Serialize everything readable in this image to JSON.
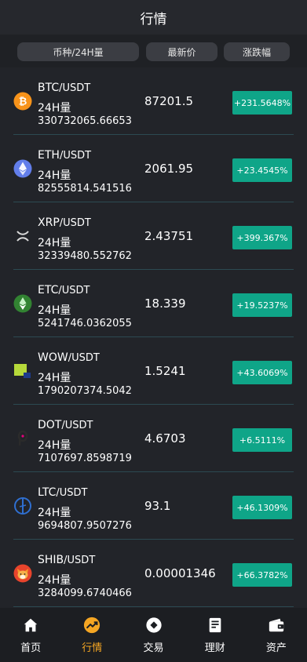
{
  "header": {
    "title": "行情"
  },
  "columns": {
    "pair": "币种/24H量",
    "price": "最新价",
    "change": "涨跌幅"
  },
  "markets": [
    {
      "base": "BTC",
      "quote": "/USDT",
      "vol_label": "24H量",
      "volume": "330732065.66653",
      "price": "87201.5",
      "change": "+231.5648%",
      "icon": "bitcoin-icon"
    },
    {
      "base": "ETH",
      "quote": "/USDT",
      "vol_label": "24H量",
      "volume": "82555814.541516",
      "price": "2061.95",
      "change": "+23.4545%",
      "icon": "ethereum-icon"
    },
    {
      "base": "XRP",
      "quote": "/USDT",
      "vol_label": "24H量",
      "volume": "32339480.552762",
      "price": "2.43751",
      "change": "+399.367%",
      "icon": "xrp-icon"
    },
    {
      "base": "ETC",
      "quote": "/USDT",
      "vol_label": "24H量",
      "volume": "5241746.0362055",
      "price": "18.339",
      "change": "+19.5237%",
      "icon": "ethereum-classic-icon"
    },
    {
      "base": "WOW",
      "quote": "/USDT",
      "vol_label": "24H量",
      "volume": "1790207374.5042",
      "price": "1.5241",
      "change": "+43.6069%",
      "icon": "wow-icon"
    },
    {
      "base": "DOT",
      "quote": "/USDT",
      "vol_label": "24H量",
      "volume": "7107697.8598719",
      "price": "4.6703",
      "change": "+6.5111%",
      "icon": "polkadot-icon"
    },
    {
      "base": "LTC",
      "quote": "/USDT",
      "vol_label": "24H量",
      "volume": "9694807.9507276",
      "price": "93.1",
      "change": "+46.1309%",
      "icon": "litecoin-icon"
    },
    {
      "base": "SHIB",
      "quote": "/USDT",
      "vol_label": "24H量",
      "volume": "3284099.6740466",
      "price": "0.00001346",
      "change": "+66.3782%",
      "icon": "shiba-inu-icon"
    }
  ],
  "tabbar": {
    "items": [
      {
        "label": "首页",
        "icon": "home-icon"
      },
      {
        "label": "行情",
        "icon": "market-trend-icon",
        "active": true
      },
      {
        "label": "交易",
        "icon": "trade-icon"
      },
      {
        "label": "理财",
        "icon": "wealth-icon"
      },
      {
        "label": "资产",
        "icon": "wallet-icon"
      }
    ]
  },
  "colors": {
    "background": "#222429",
    "up": "#0fa588",
    "active_tab": "#f5a623",
    "divider": "#2c4a52"
  }
}
